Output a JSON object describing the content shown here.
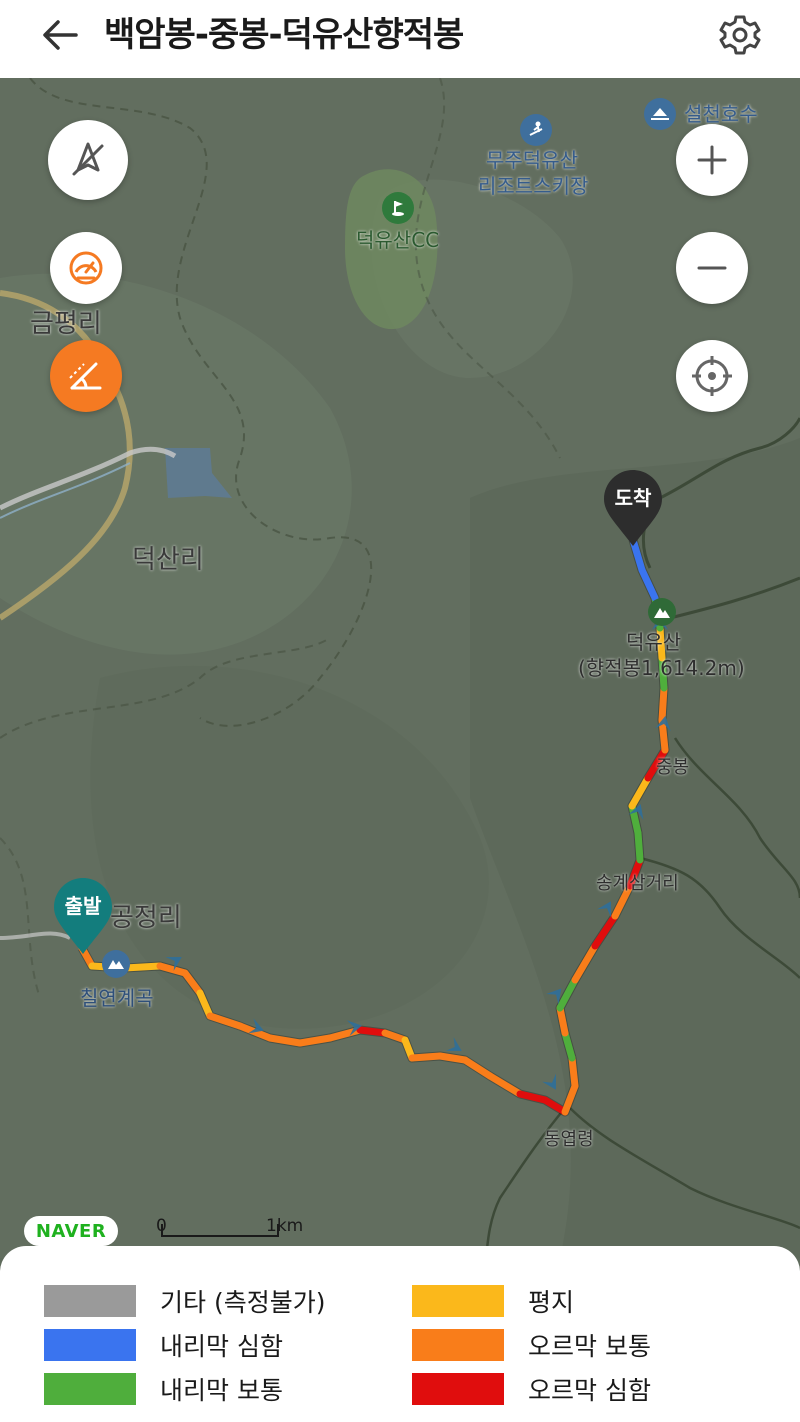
{
  "header": {
    "title": "백암봉-중봉-덕유산향적봉"
  },
  "map": {
    "labels": {
      "seolcheon_lake": "설천호수",
      "resort_line1": "무주덕유산",
      "resort_line2": "리조트스키장",
      "golf_cc": "덕유산CC",
      "geumpyeong": "금평리",
      "deoksan": "덕산리",
      "deogyusan_line1": "덕유산",
      "deogyusan_line2": "(향적봉1,614.2m)",
      "jungbong": "중봉",
      "songgye_junction": "송계삼거리",
      "gongjeong": "공정리",
      "chilyeon_valley": "칠연계곡",
      "dongyeopryeong": "동엽령"
    },
    "pins": {
      "start": "출발",
      "end": "도착"
    },
    "branding": "NAVER",
    "scale": {
      "start_label": "0",
      "end_label": "1km"
    }
  },
  "legend": {
    "items": [
      {
        "label": "기타 (측정불가)",
        "color": "#9a9a9a"
      },
      {
        "label": "평지",
        "color": "#fbb81b"
      },
      {
        "label": "내리막 심함",
        "color": "#3a74ef"
      },
      {
        "label": "오르막 보통",
        "color": "#f97d1a"
      },
      {
        "label": "내리막 보통",
        "color": "#4fae3c"
      },
      {
        "label": "오르막 심함",
        "color": "#e00d0d"
      }
    ]
  },
  "colors": {
    "orange_button": "#f57a22",
    "start_pin": "#137d7d",
    "end_pin": "#2d2d2d"
  }
}
